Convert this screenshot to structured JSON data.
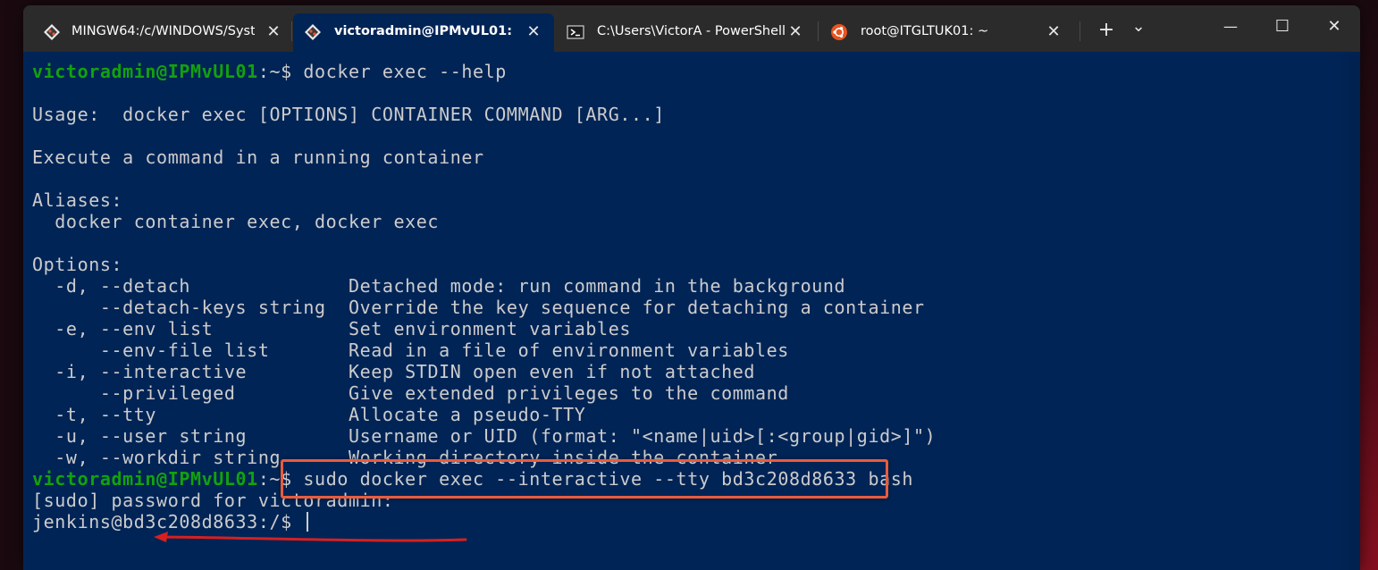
{
  "tabs": [
    {
      "title": "MINGW64:/c/WINDOWS/Syst",
      "icon": "git-bash-icon"
    },
    {
      "title": "victoradmin@IPMvUL01: ~",
      "icon": "git-bash-icon",
      "active": true
    },
    {
      "title": "C:\\Users\\VictorA - PowerShell",
      "icon": "powershell-icon"
    },
    {
      "title": "root@ITGLTUK01: ~",
      "icon": "ubuntu-icon"
    }
  ],
  "titlebar": {
    "new_tab": "+",
    "dropdown": "⌄",
    "minimize": "—",
    "maximize": "☐",
    "close": "✕"
  },
  "terminal": {
    "prompt_user": "victoradmin@IPMvUL01",
    "prompt_path": ":~$ ",
    "cmd1": "docker exec --help",
    "usage": "Usage:  docker exec [OPTIONS] CONTAINER COMMAND [ARG...]",
    "description": "Execute a command in a running container",
    "aliases_header": "Aliases:",
    "aliases": "  docker container exec, docker exec",
    "options_header": "Options:",
    "options": [
      {
        "flag": "  -d, --detach              ",
        "desc": "Detached mode: run command in the background"
      },
      {
        "flag": "      --detach-keys string  ",
        "desc": "Override the key sequence for detaching a container"
      },
      {
        "flag": "  -e, --env list            ",
        "desc": "Set environment variables"
      },
      {
        "flag": "      --env-file list       ",
        "desc": "Read in a file of environment variables"
      },
      {
        "flag": "  -i, --interactive         ",
        "desc": "Keep STDIN open even if not attached"
      },
      {
        "flag": "      --privileged          ",
        "desc": "Give extended privileges to the command"
      },
      {
        "flag": "  -t, --tty                 ",
        "desc": "Allocate a pseudo-TTY"
      },
      {
        "flag": "  -u, --user string         ",
        "desc": "Username or UID (format: \"<name|uid>[:<group|gid>]\")"
      },
      {
        "flag": "  -w, --workdir string      ",
        "desc": "Working directory inside the container"
      }
    ],
    "cmd2": "sudo docker exec --interactive --tty bd3c208d8633 bash",
    "sudo_prompt": "[sudo] password for victoradmin:",
    "container_prompt": "jenkins@bd3c208d8633:/$ "
  },
  "colors": {
    "terminal_bg": "#012456",
    "prompt_green": "#13a10e",
    "highlight_border": "#e85c3e",
    "arrow_red": "#d62020"
  }
}
